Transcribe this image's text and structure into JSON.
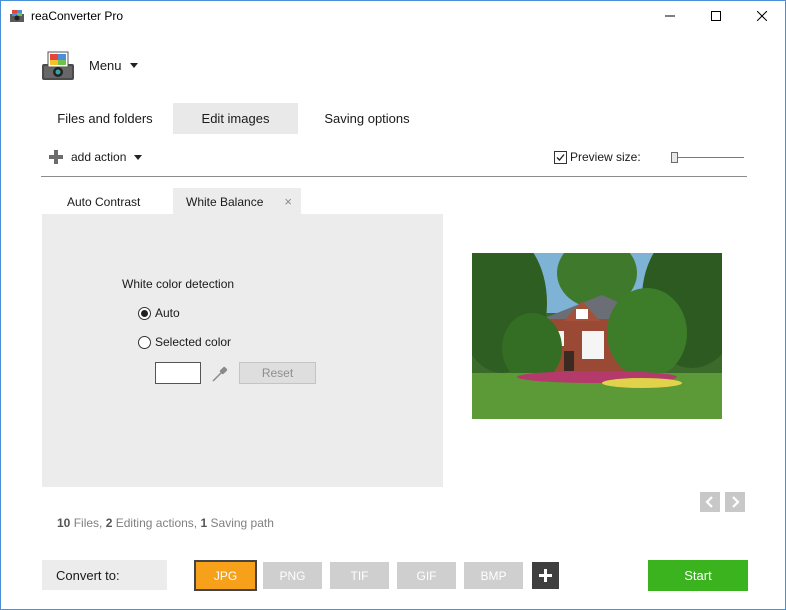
{
  "window": {
    "title": "reaConverter Pro",
    "icons": {
      "app": "app-icon",
      "minimize": "minimize-icon",
      "maximize": "maximize-icon",
      "close": "close-icon"
    }
  },
  "menu": {
    "label": "Menu",
    "icon": "chevron-down-icon"
  },
  "main_tabs": [
    {
      "label": "Files and folders",
      "active": false
    },
    {
      "label": "Edit images",
      "active": true
    },
    {
      "label": "Saving options",
      "active": false
    }
  ],
  "toolbar": {
    "add_action_label": "add action",
    "preview_label": "Preview size:",
    "preview_checked": true
  },
  "sub_tabs": [
    {
      "label": "Auto Contrast",
      "active": false
    },
    {
      "label": "White Balance",
      "active": true,
      "close": "×"
    }
  ],
  "white_balance": {
    "heading": "White color detection",
    "options": [
      {
        "label": "Auto",
        "selected": true
      },
      {
        "label": "Selected color",
        "selected": false
      }
    ],
    "reset_label": "Reset",
    "swatch_color": "#ffffff"
  },
  "stats": {
    "files_count": "10",
    "files_label": "Files,",
    "editing_count": "2",
    "editing_label": "Editing actions,",
    "saving_count": "1",
    "saving_label": "Saving path"
  },
  "convert": {
    "label": "Convert to:",
    "formats": [
      {
        "label": "JPG",
        "active": true
      },
      {
        "label": "PNG",
        "active": false
      },
      {
        "label": "TIF",
        "active": false
      },
      {
        "label": "GIF",
        "active": false
      },
      {
        "label": "BMP",
        "active": false
      }
    ],
    "start_label": "Start"
  },
  "colors": {
    "accent_orange": "#f7a11a",
    "start_green": "#3bb31f",
    "panel_grey": "#ececec"
  }
}
